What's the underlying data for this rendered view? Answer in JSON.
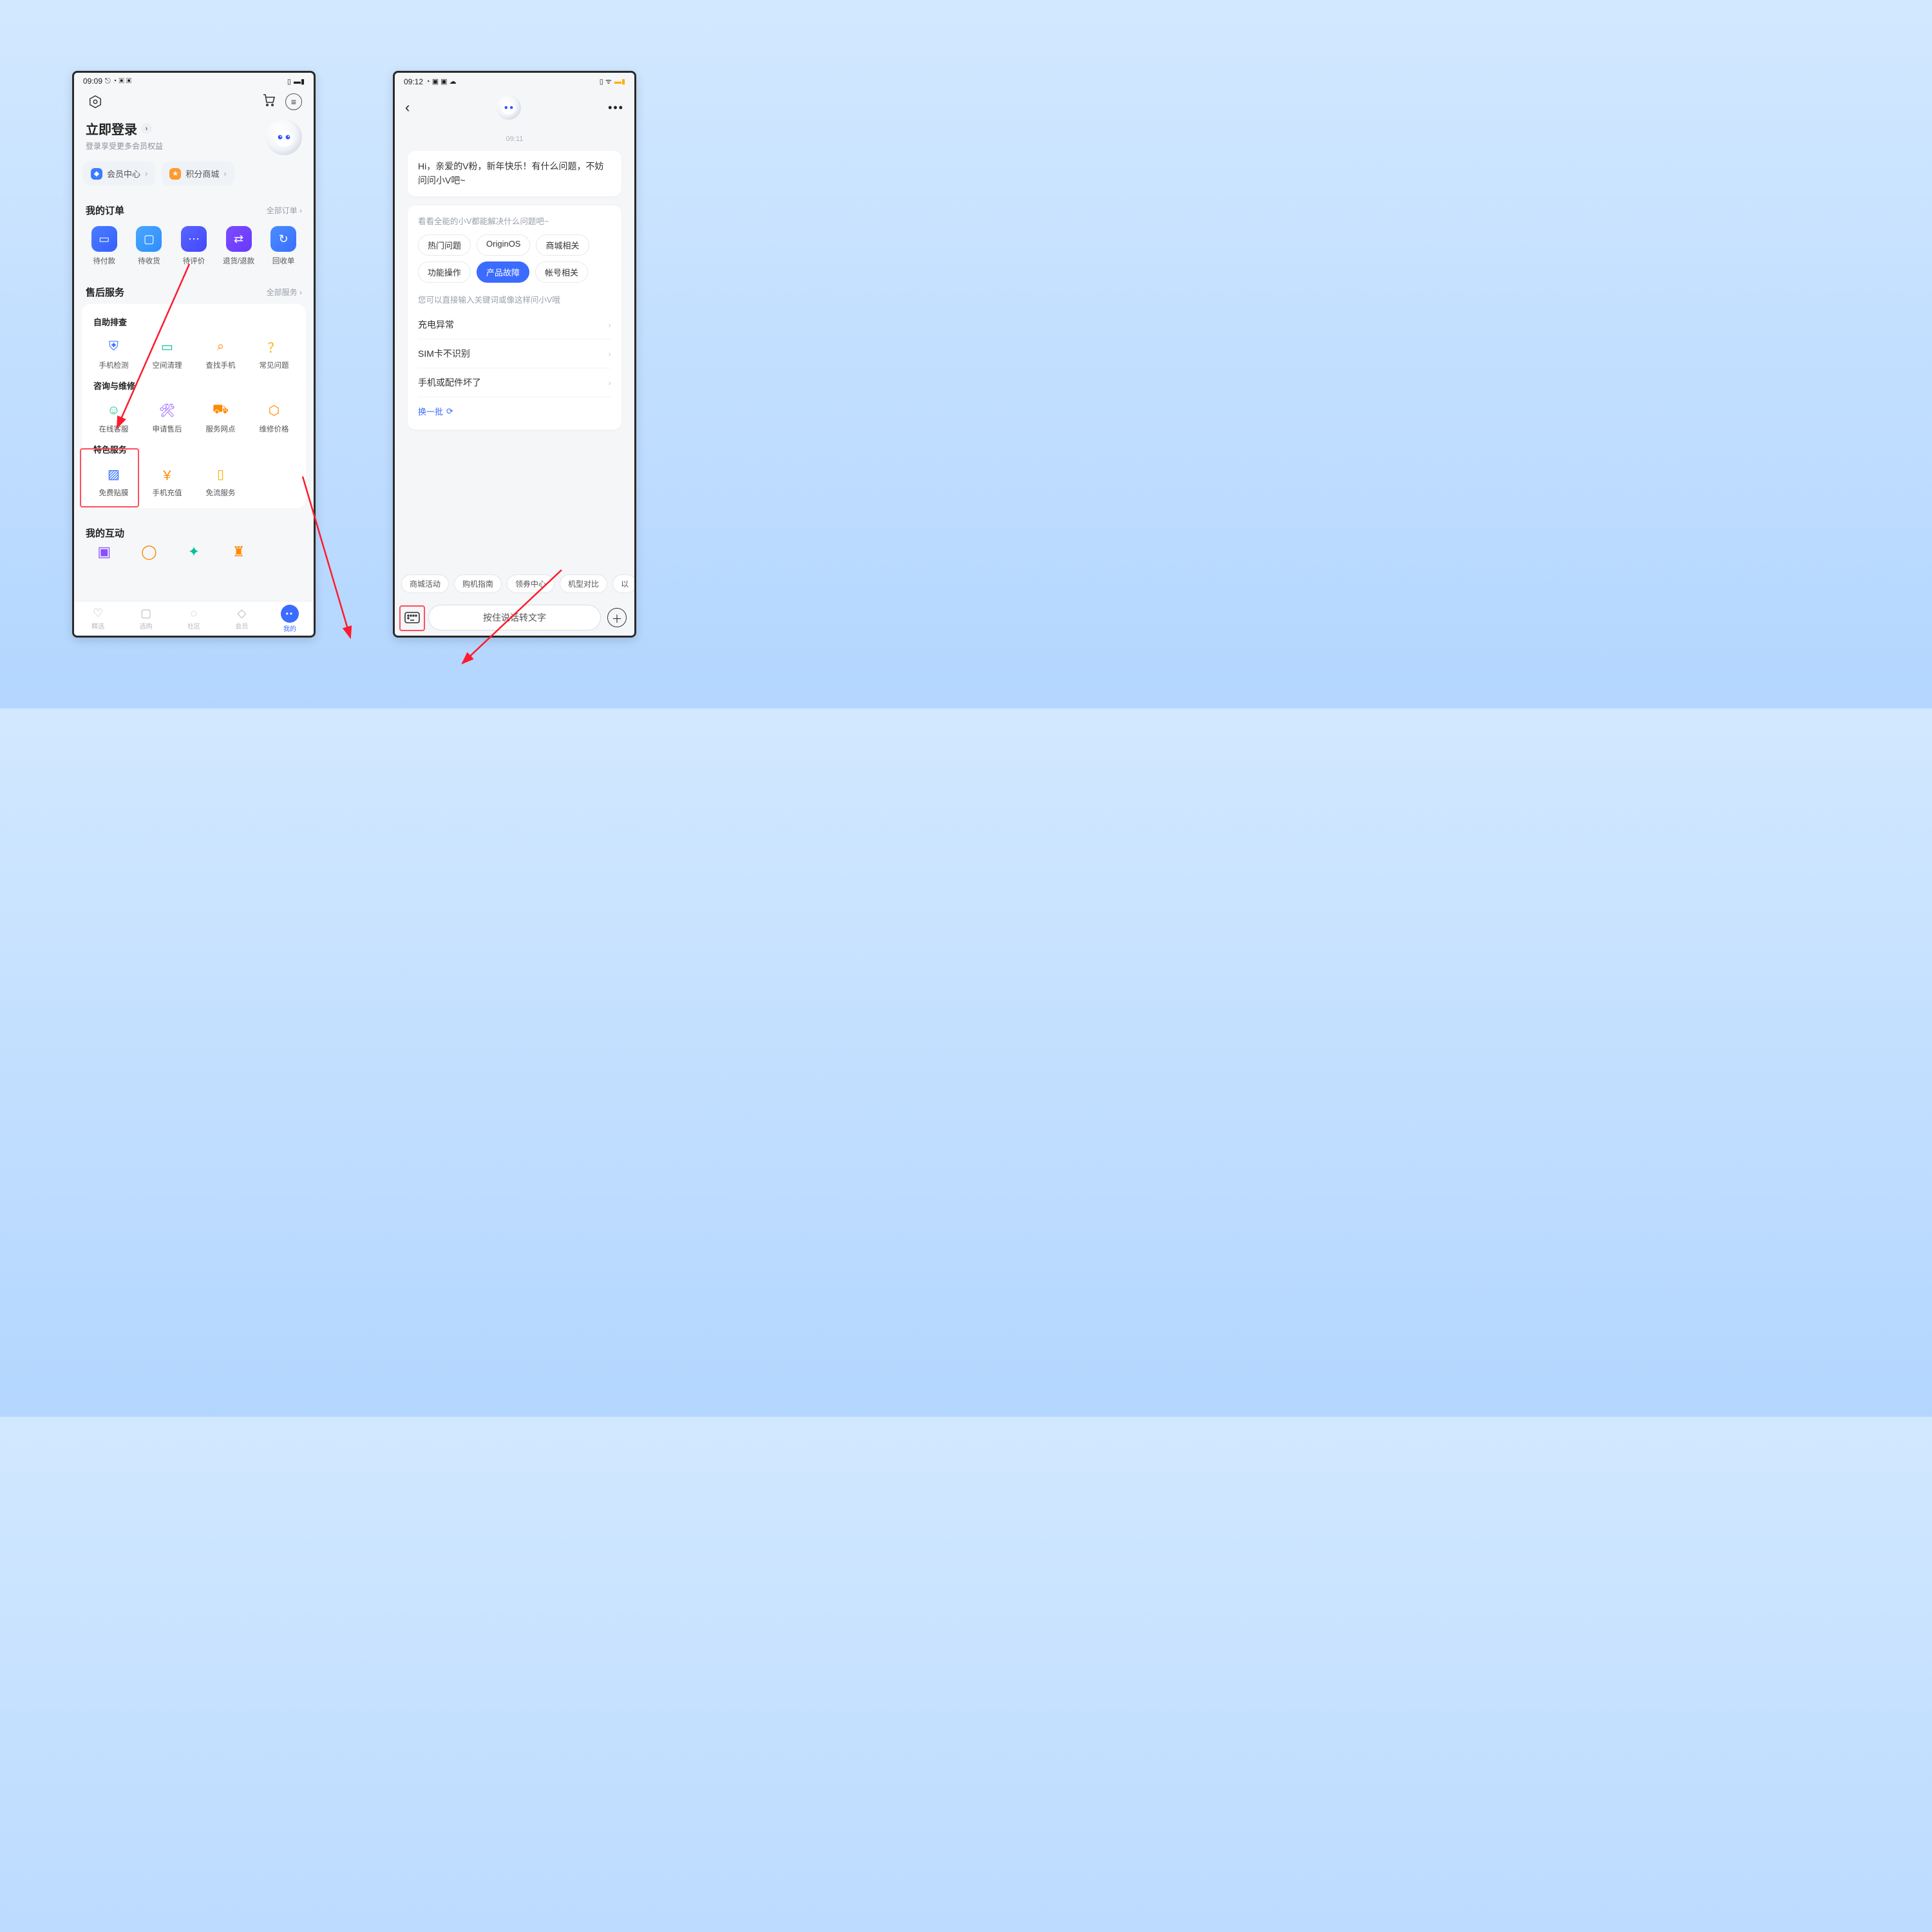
{
  "left": {
    "status": {
      "time": "09:09"
    },
    "login": {
      "title": "立即登录",
      "sub": "登录享受更多会员权益"
    },
    "pills": {
      "member": "会员中心",
      "points": "积分商城"
    },
    "orders_h": "我的订单",
    "orders_more": "全部订单",
    "orders": [
      {
        "label": "待付款"
      },
      {
        "label": "待收货"
      },
      {
        "label": "待评价"
      },
      {
        "label": "退货/退款"
      },
      {
        "label": "回收单"
      }
    ],
    "service_h": "售后服务",
    "service_more": "全部服务",
    "g1": "自助排查",
    "g1_items": [
      {
        "label": "手机检测"
      },
      {
        "label": "空间清理"
      },
      {
        "label": "查找手机"
      },
      {
        "label": "常见问题"
      }
    ],
    "g2": "咨询与维修",
    "g2_items": [
      {
        "label": "在线客服"
      },
      {
        "label": "申请售后"
      },
      {
        "label": "服务网点"
      },
      {
        "label": "维修价格"
      }
    ],
    "g3": "特色服务",
    "g3_items": [
      {
        "label": "免费贴膜"
      },
      {
        "label": "手机充值"
      },
      {
        "label": "免流服务"
      }
    ],
    "interact_h": "我的互动",
    "nav": [
      {
        "label": "精选"
      },
      {
        "label": "选购"
      },
      {
        "label": "社区"
      },
      {
        "label": "会员"
      },
      {
        "label": "我的"
      }
    ]
  },
  "right": {
    "status": {
      "time": "09:12"
    },
    "time_label": "09:11",
    "greet": "Hi，亲爱的V粉，新年快乐！有什么问题，不妨问问小V吧~",
    "hint1": "看看全能的小V都能解决什么问题吧~",
    "chips": [
      {
        "t": "热门问题",
        "on": false
      },
      {
        "t": "OriginOS",
        "on": false
      },
      {
        "t": "商城相关",
        "on": false
      },
      {
        "t": "功能操作",
        "on": false
      },
      {
        "t": "产品故障",
        "on": true
      },
      {
        "t": "帐号相关",
        "on": false
      }
    ],
    "hint2": "您可以直接输入关键词或像这样问小V哦",
    "questions": [
      "充电异常",
      "SIM卡不识别",
      "手机或配件坏了"
    ],
    "refresh": "换一批",
    "suggestions": [
      "商城活动",
      "购机指南",
      "领券中心",
      "机型对比",
      "以"
    ],
    "voice": "按住说话转文字"
  }
}
